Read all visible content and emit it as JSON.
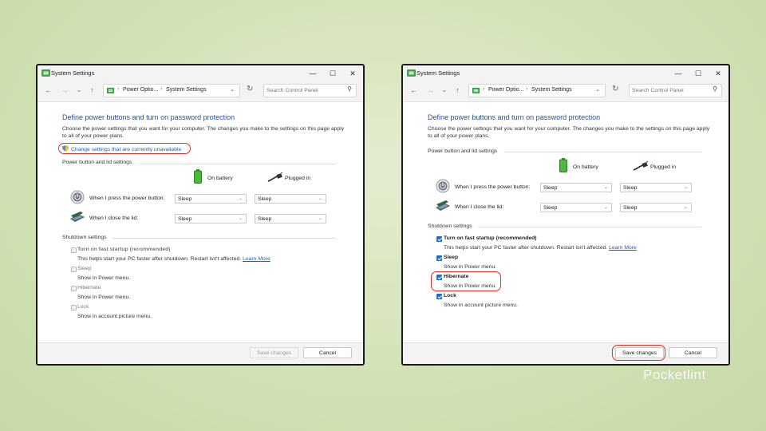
{
  "watermark": "Pocketlint",
  "colors": {
    "accent": "#1f6fc5",
    "link": "#1a5fb4",
    "title_blue": "#1f55a0",
    "highlight_red": "#d8342a",
    "background_green": "#d3e2b6"
  },
  "icons": [
    "control-panel-icon",
    "back-arrow-icon",
    "forward-arrow-icon",
    "chevron-down-icon",
    "up-arrow-icon",
    "refresh-icon",
    "search-icon",
    "shield-icon",
    "battery-icon",
    "plug-icon",
    "power-button-icon",
    "laptop-lid-icon",
    "minimize-icon",
    "maximize-icon",
    "close-icon"
  ],
  "left": {
    "window_title": "System Settings",
    "breadcrumb": [
      "Power Optio...",
      "System Settings"
    ],
    "search_placeholder": "Search Control Panel",
    "heading": "Define power buttons and turn on password protection",
    "description": "Choose the power settings that you want for your computer. The changes you make to the settings on this page apply to all of your power plans.",
    "change_link": "Change settings that are currently unavailable",
    "power_group": "Power button and lid settings",
    "col_battery": "On battery",
    "col_plugged": "Plugged in",
    "row_power": "When I press the power button:",
    "row_lid": "When I close the lid:",
    "power_battery": "Sleep",
    "power_plugged": "Sleep",
    "lid_battery": "Sleep",
    "lid_plugged": "Sleep",
    "shutdown_group": "Shutdown settings",
    "fast_title": "Turn on fast startup (recommended)",
    "fast_desc": "This helps start your PC faster after shutdown. Restart isn't affected.",
    "learn_more": "Learn More",
    "sleep_title": "Sleep",
    "sleep_desc": "Show in Power menu.",
    "hib_title": "Hibernate",
    "hib_desc": "Show in Power menu.",
    "lock_title": "Lock",
    "lock_desc": "Show in account picture menu.",
    "fast_checked": false,
    "sleep_checked": false,
    "hib_checked": false,
    "lock_checked": false,
    "save": "Save changes",
    "cancel": "Cancel"
  },
  "right": {
    "window_title": "System Settings",
    "breadcrumb": [
      "Power Optio...",
      "System Settings"
    ],
    "search_placeholder": "Search Control Panel",
    "heading": "Define power buttons and turn on password protection",
    "description": "Choose the power settings that you want for your computer. The changes you make to the settings on this page apply to all of your power plans.",
    "power_group": "Power button and lid settings",
    "col_battery": "On battery",
    "col_plugged": "Plugged in",
    "row_power": "When I press the power button:",
    "row_lid": "When I close the lid:",
    "power_battery": "Sleep",
    "power_plugged": "Sleep",
    "lid_battery": "Sleep",
    "lid_plugged": "Sleep",
    "shutdown_group": "Shutdown settings",
    "fast_title": "Turn on fast startup (recommended)",
    "fast_desc": "This helps start your PC faster after shutdown. Restart isn't affected.",
    "learn_more": "Learn More",
    "sleep_title": "Sleep",
    "sleep_desc": "Show in Power menu.",
    "hib_title": "Hibernate",
    "hib_desc": "Show in Power menu.",
    "lock_title": "Lock",
    "lock_desc": "Show in account picture menu.",
    "fast_checked": true,
    "sleep_checked": true,
    "hib_checked": true,
    "lock_checked": true,
    "save": "Save changes",
    "cancel": "Cancel"
  }
}
